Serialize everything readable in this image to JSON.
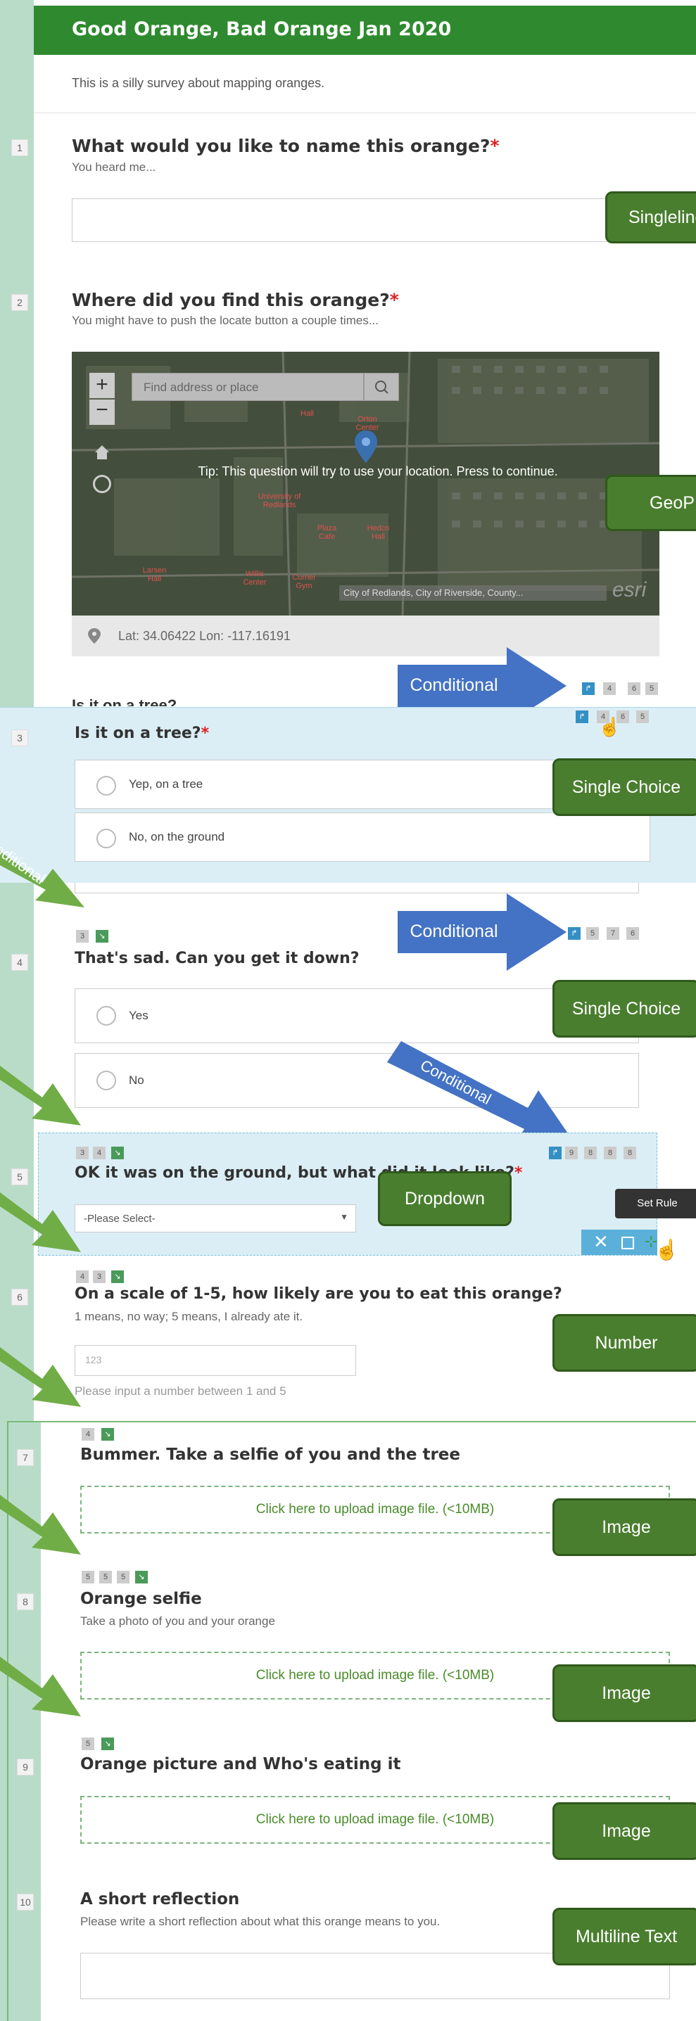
{
  "survey": {
    "title": "Good Orange, Bad Orange Jan 2020",
    "description": "This is a silly survey about mapping oranges."
  },
  "q1": {
    "num": "1",
    "title": "What would you like to name this orange?",
    "required": "*",
    "hint": "You heard me...",
    "tag": "Singleline"
  },
  "q2": {
    "num": "2",
    "title": "Where did you find this orange?",
    "required": "*",
    "hint": "You might have to push the locate button a couple times...",
    "search_placeholder": "Find address or place",
    "tip": "Tip: This question will try to use your location. Press to continue.",
    "attribution": "City of Redlands, City of Riverside, County...",
    "esri": "esri",
    "coords": "Lat: 34.06422 Lon: -117.16191",
    "tag": "GeoP",
    "map_labels": [
      "University of Redlands",
      "Orton Center",
      "Hall",
      "Plaza Cafe",
      "Hedco Hall",
      "Larsen Hall",
      "Willis Center",
      "Currier Gym"
    ]
  },
  "cond_label": "Conditional",
  "partial_title": "Is it on a tree?",
  "q3": {
    "num": "3",
    "title": "Is it on a tree?",
    "required": "*",
    "options": [
      "Yep, on a tree",
      "No, on the ground"
    ],
    "tag": "Single Choice",
    "badges": [
      "4",
      "6",
      "5"
    ]
  },
  "side_label": "Conditional",
  "q4": {
    "num": "4",
    "title": "That's sad.  Can you get it down?",
    "options": [
      "Yes",
      "No"
    ],
    "tag": "Single Choice",
    "badges": [
      "5",
      "7",
      "6"
    ],
    "pre": [
      "3"
    ]
  },
  "q5": {
    "num": "5",
    "title": "OK it was on the ground, but what did it look like?",
    "required": "*",
    "select": "-Please Select-",
    "tag": "Dropdown",
    "tooltip": "Set Rule",
    "badges": [
      "9",
      "8",
      "8",
      "8"
    ],
    "pre": [
      "3",
      "4"
    ]
  },
  "q6": {
    "num": "6",
    "title": "On a scale of 1-5, how likely are you to eat this orange?",
    "hint": "1 means, no way; 5 means, I already ate it.",
    "placeholder": "123",
    "validation": "Please input a number between 1 and 5",
    "tag": "Number",
    "pre": [
      "4",
      "3"
    ]
  },
  "q7": {
    "num": "7",
    "title": "Bummer. Take a selfie of you and the tree",
    "upload": "Click here to upload image file. (<10MB)",
    "tag": "Image",
    "pre": [
      "4"
    ]
  },
  "q8": {
    "num": "8",
    "title": "Orange selfie",
    "hint": "Take a photo of you and your orange",
    "upload": "Click here to upload image file. (<10MB)",
    "tag": "Image",
    "pre": [
      "5",
      "5",
      "5"
    ]
  },
  "q9": {
    "num": "9",
    "title": "Orange picture and Who's eating it",
    "upload": "Click here to upload image file. (<10MB)",
    "tag": "Image",
    "pre": [
      "5"
    ]
  },
  "q10": {
    "num": "10",
    "title": "A short reflection",
    "hint": "Please write a short reflection about what this orange means to you.",
    "tag": "Multiline Text"
  },
  "colors": {
    "header": "#2f8a2f",
    "strip": "#b9dcc9",
    "tag": "#4a7e2f",
    "arrow_blue": "#4472c4",
    "arrow_green": "#70ad47",
    "hover": "#dbeef5"
  }
}
